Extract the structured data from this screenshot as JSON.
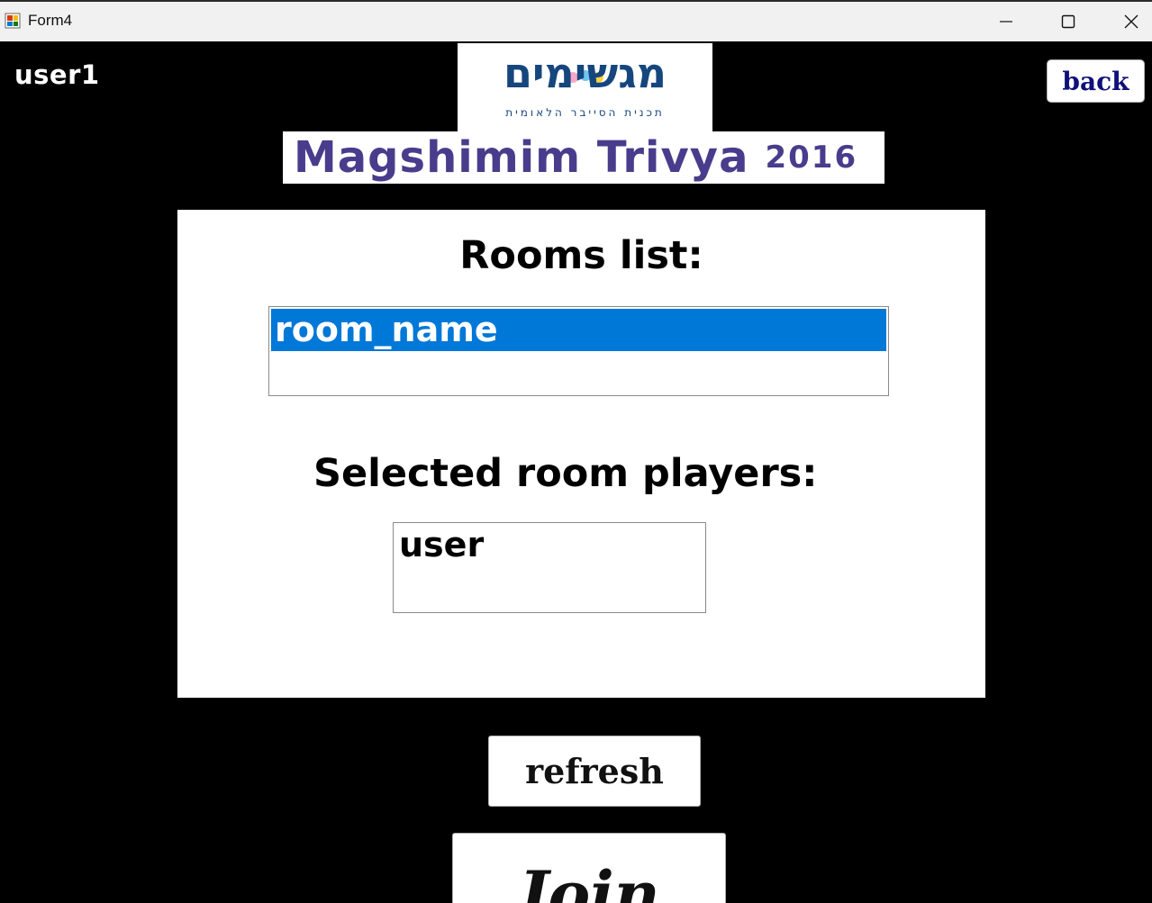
{
  "window": {
    "title": "Form4",
    "minimize_icon": "minimize-icon",
    "maximize_icon": "maximize-icon",
    "close_icon": "close-icon"
  },
  "header": {
    "username": "user1",
    "back_label": "back",
    "logo_hebrew": "מגשימים",
    "logo_subtitle": "תכנית הסייבר הלאומית",
    "app_title": "Magshimim Trivya",
    "app_year": "2016"
  },
  "rooms": {
    "label": "Rooms list:",
    "items": [
      "room_name"
    ],
    "selected_index": 0
  },
  "players": {
    "label": "Selected room players:",
    "items": [
      "user"
    ]
  },
  "actions": {
    "refresh_label": "refresh",
    "join_label": "Join"
  },
  "colors": {
    "selection": "#0078d7",
    "title_purple": "#4a3c8c",
    "logo_blue": "#16467e",
    "back_text": "#10107a"
  }
}
